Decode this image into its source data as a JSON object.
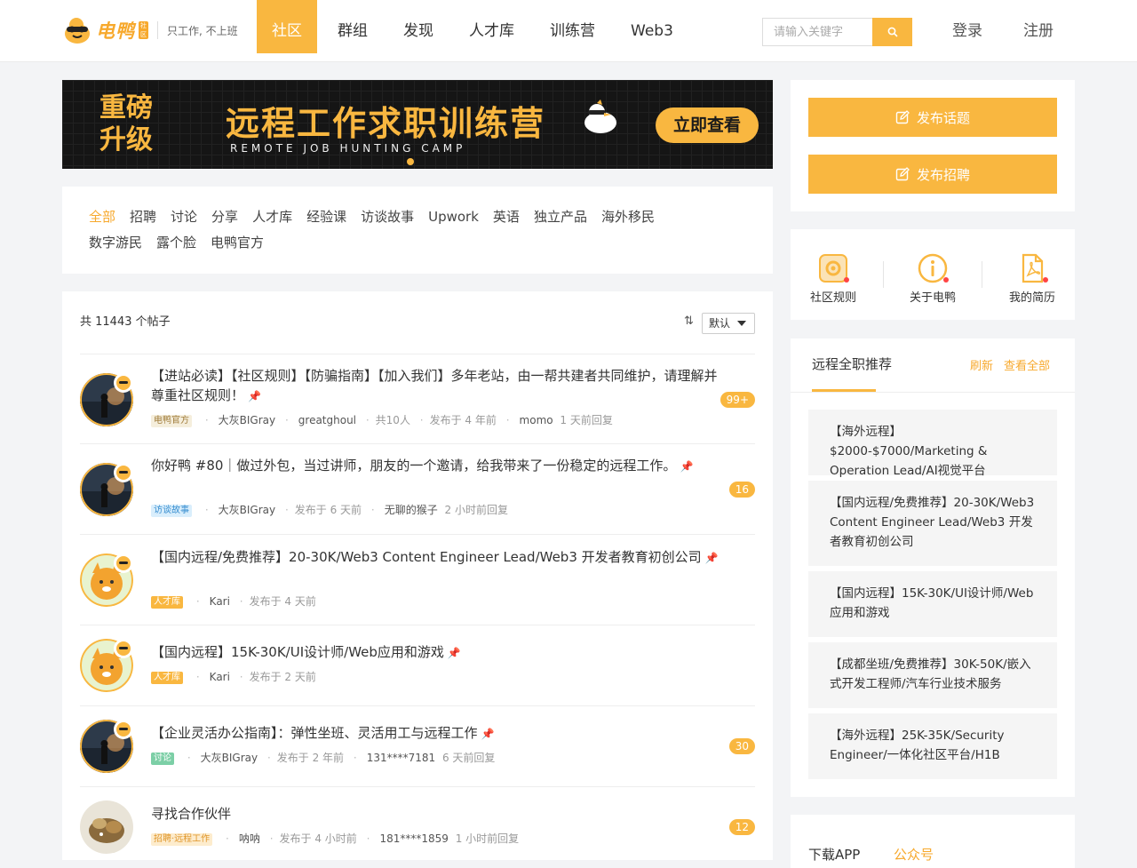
{
  "header": {
    "brand": "电鸭",
    "brand_badge": "社区",
    "slogan": "只工作, 不上班",
    "nav": [
      "社区",
      "群组",
      "发现",
      "人才库",
      "训练营",
      "Web3"
    ],
    "nav_active": "社区",
    "search_placeholder": "请输入关键字",
    "login": "登录",
    "register": "注册"
  },
  "banner": {
    "left_line1": "重磅",
    "left_line2": "升级",
    "title": "远程工作求职训练营",
    "subtitle": "REMOTE JOB HUNTING CAMP",
    "button": "立即查看"
  },
  "categories": [
    "全部",
    "招聘",
    "讨论",
    "分享",
    "人才库",
    "经验课",
    "访谈故事",
    "Upwork",
    "英语",
    "独立产品",
    "海外移民",
    "数字游民",
    "露个脸",
    "电鸭官方"
  ],
  "categories_active": "全部",
  "feed": {
    "count_text": "共 11443 个帖子",
    "sort_value": "默认",
    "posts": [
      {
        "title": "【进站必读】【社区规则】【防骗指南】【加入我们】多年老站，由一帮共建者共同维护，请理解并尊重社区规则！",
        "tag": "电鸭官方",
        "author": "大灰BIGray",
        "coauthor": "greatghoul",
        "people": "共10人",
        "published": "发布于 4 年前",
        "last_user": "momo",
        "last_reply": "1 天前回复",
        "replies": "99+"
      },
      {
        "title": "你好鸭 #80｜做过外包，当过讲师，朋友的一个邀请，给我带来了一份稳定的远程工作。",
        "tag": "访谈故事",
        "author": "大灰BIGray",
        "published": "发布于 6 天前",
        "last_user": "无聊的猴子",
        "last_reply": "2 小时前回复",
        "replies": "16"
      },
      {
        "title": "【国内远程/免费推荐】20-30K/Web3 Content Engineer Lead/Web3 开发者教育初创公司",
        "tag": "人才库",
        "author": "Kari",
        "published": "发布于 4 天前"
      },
      {
        "title": "【国内远程】15K-30K/UI设计师/Web应用和游戏",
        "tag": "人才库",
        "author": "Kari",
        "published": "发布于 2 天前"
      },
      {
        "title": "【企业灵活办公指南】：弹性坐班、灵活用工与远程工作",
        "tag": "讨论",
        "author": "大灰BIGray",
        "published": "发布于 2 年前",
        "last_user": "131****7181",
        "last_reply": "6 天前回复",
        "replies": "30"
      },
      {
        "title": "寻找合作伙伴",
        "tag": "招聘·远程工作",
        "author": "呐呐",
        "published": "发布于 4 小时前",
        "last_user": "181****1859",
        "last_reply": "1 小时前回复",
        "replies": "12"
      }
    ]
  },
  "publish": {
    "topic": "发布话题",
    "job": "发布招聘"
  },
  "quick_links": [
    "社区规则",
    "关于电鸭",
    "我的简历"
  ],
  "recommend": {
    "title": "远程全职推荐",
    "refresh": "刷新",
    "view_all": "查看全部",
    "items": [
      "【海外远程】$2000-$7000/Marketing & Operation Lead/AI视觉平台",
      "【国内远程/免费推荐】20-30K/Web3 Content Engineer Lead/Web3 开发者教育初创公司",
      "【国内远程】15K-30K/UI设计师/Web应用和游戏",
      "【成都坐班/免费推荐】30K-50K/嵌入式开发工程师/汽车行业技术服务",
      "【海外远程】25K-35K/Security Engineer/一体化社区平台/H1B"
    ]
  },
  "app_tabs": [
    "下载APP",
    "公众号"
  ],
  "colors": {
    "accent": "#f9b740",
    "accent_text": "#f7a92d",
    "tag_official_bg": "#f5eedc",
    "tag_interview_bg": "#d9eefc",
    "tag_talent_bg": "#f9b740",
    "tag_discuss_bg": "#7ccfa6"
  }
}
